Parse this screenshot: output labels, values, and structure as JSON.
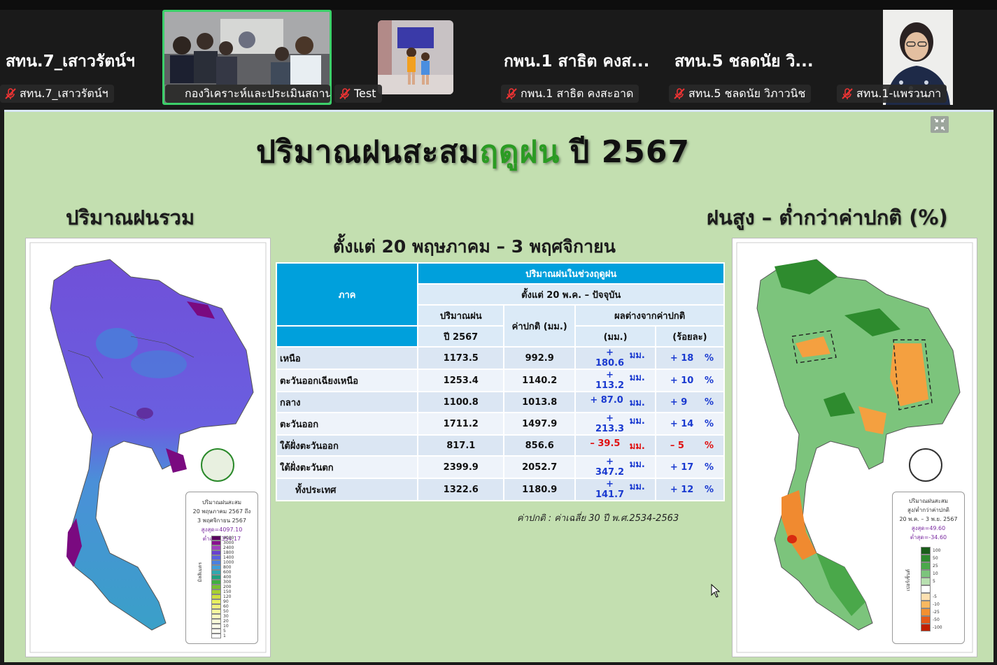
{
  "participants": [
    {
      "display_name": "สทน.7_เสาวรัตน์ฯ",
      "label": "สทน.7_เสาวรัตน์ฯ"
    },
    {
      "label": "กองวิเคราะห์และประเมินสถาน..."
    },
    {
      "label": "Test"
    },
    {
      "display_name": "กพน.1 สาธิต คงส...",
      "label": "กพน.1 สาธิต คงสะอาด"
    },
    {
      "display_name": "สทน.5 ชลดนัย วิ...",
      "label": "สทน.5 ชลดนัย วิภาวนิช"
    },
    {
      "label": "สทน.1-แพรวนภา"
    }
  ],
  "slide": {
    "title_part1": "ปริมาณฝนสะสม",
    "title_accent": "ฤดูฝน",
    "title_part2": "ปี 2567",
    "left_heading": "ปริมาณฝนรวม",
    "right_heading": "ฝนสูง – ต่ำกว่าค่าปกติ (%)",
    "sub_heading": "ตั้งแต่ 20 พฤษภาคม – 3 พฤศจิกายน",
    "note": "ค่าปกติ : ค่าเฉลี่ย 30 ปี พ.ศ.2534-2563",
    "left_map_legend": {
      "title": "ปริมาณฝนสะสม",
      "lines": [
        "20 พฤษภาคม 2567 ถึง",
        "3 พฤศจิกายน 2567",
        "สูงสุด=4097.10",
        "ต่ำสุด=354.17"
      ],
      "scale": [
        "4000",
        "3000",
        "2400",
        "1800",
        "1400",
        "1000",
        "800",
        "600",
        "400",
        "300",
        "200",
        "150",
        "120",
        "90",
        "60",
        "50",
        "30",
        "20",
        "10",
        "5",
        "1"
      ],
      "colors": [
        "#5a0060",
        "#8a1090",
        "#a040c0",
        "#6a40d0",
        "#5a60e0",
        "#4a80e0",
        "#3f9ed8",
        "#30a8b0",
        "#20a080",
        "#40b040",
        "#78c030",
        "#a8d030",
        "#d0e040",
        "#e8f060",
        "#f0f080",
        "#f4f8a0",
        "#f8fac0",
        "#fafcd8",
        "#fcfde8",
        "#fefef4",
        "#ffffff"
      ],
      "unit": "มิลลิเมตร"
    },
    "right_map_legend": {
      "title": "ปริมาณฝนสะสม",
      "lines": [
        "สูง/ต่ำกว่าค่าปกติ",
        "20 พ.ค. – 3 พ.ย. 2567",
        "สูงสุด=49.60",
        "ต่ำสุด=-34.60"
      ],
      "scale": [
        "100",
        "50",
        "25",
        "10",
        "5",
        "",
        "-5",
        "-10",
        "-25",
        "-50",
        "-100"
      ],
      "colors": [
        "#1a5e1a",
        "#2e8b2e",
        "#4aa84a",
        "#7cc47c",
        "#b8e0b0",
        "#ffffff",
        "#fde0b0",
        "#f9b860",
        "#f39030",
        "#e45818",
        "#c02000"
      ],
      "unit": "เปอร์เซ็นต์"
    },
    "table": {
      "h_region": "ภาค",
      "h_main": "ปริมาณฝนในช่วงฤดูฝน",
      "h_period": "ตั้งแต่ 20 พ.ค. – ปัจจุบัน",
      "h_rain": "ปริมาณฝน",
      "h_year": "ปี 2567",
      "h_normal": "ค่าปกติ (มม.)",
      "h_diff": "ผลต่างจากค่าปกติ",
      "h_mm": "(มม.)",
      "h_pct": "(ร้อยละ)",
      "unit_mm": "มม.",
      "unit_pct": "%",
      "rows": [
        {
          "region": "เหนือ",
          "rain": "1173.5",
          "normal": "992.9",
          "diff_mm": "+ 180.6",
          "diff_pct": "+ 18",
          "sign": "pos"
        },
        {
          "region": "ตะวันออกเฉียงเหนือ",
          "rain": "1253.4",
          "normal": "1140.2",
          "diff_mm": "+ 113.2",
          "diff_pct": "+ 10",
          "sign": "pos"
        },
        {
          "region": "กลาง",
          "rain": "1100.8",
          "normal": "1013.8",
          "diff_mm": "+ 87.0",
          "diff_pct": "+ 9",
          "sign": "pos"
        },
        {
          "region": "ตะวันออก",
          "rain": "1711.2",
          "normal": "1497.9",
          "diff_mm": "+ 213.3",
          "diff_pct": "+ 14",
          "sign": "pos"
        },
        {
          "region": "ใต้ฝั่งตะวันออก",
          "rain": "817.1",
          "normal": "856.6",
          "diff_mm": "– 39.5",
          "diff_pct": "– 5",
          "sign": "neg"
        },
        {
          "region": "ใต้ฝั่งตะวันตก",
          "rain": "2399.9",
          "normal": "2052.7",
          "diff_mm": "+ 347.2",
          "diff_pct": "+ 17",
          "sign": "pos"
        },
        {
          "region": "ทั้งประเทศ",
          "rain": "1322.6",
          "normal": "1180.9",
          "diff_mm": "+ 141.7",
          "diff_pct": "+ 12",
          "sign": "pos"
        }
      ]
    }
  }
}
